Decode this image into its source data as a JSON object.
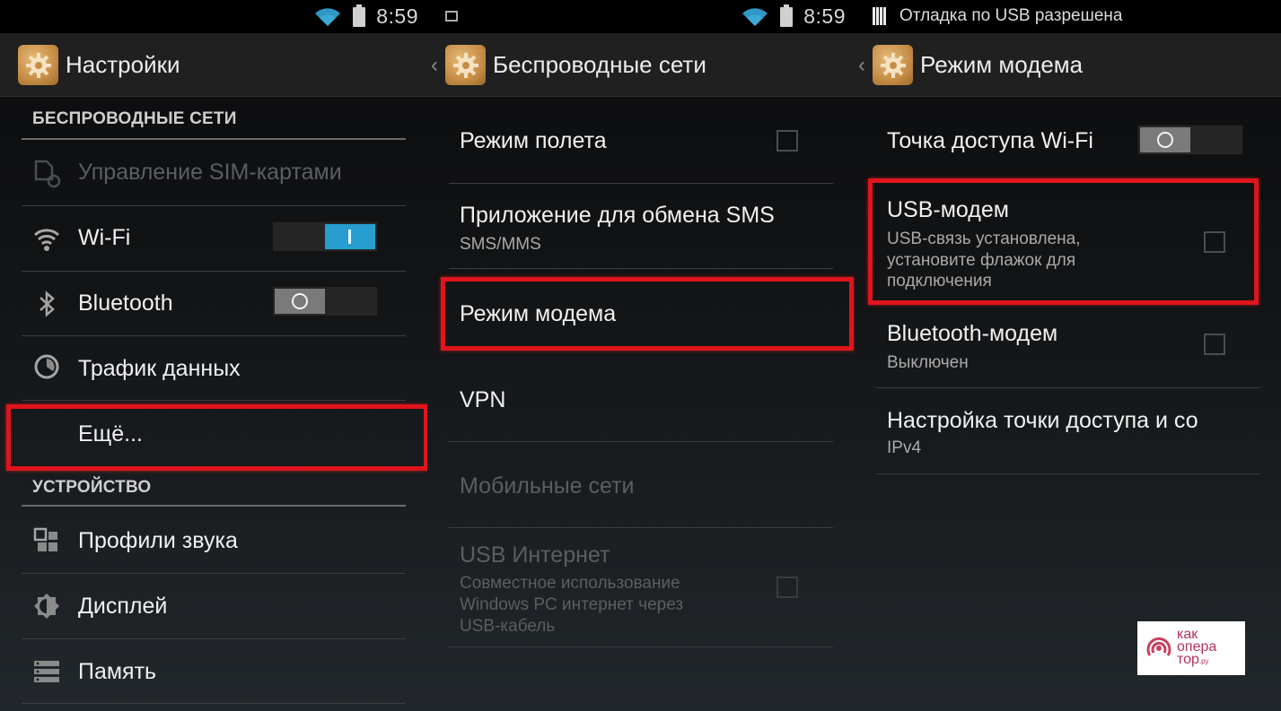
{
  "panel_settings": {
    "status": {
      "time": "8:59"
    },
    "title": "Настройки",
    "sections": [
      {
        "header": "БЕСПРОВОДНЫЕ СЕТИ",
        "items": [
          {
            "label": "Управление SIM-картами",
            "icon": "sim-settings-icon",
            "disabled": true
          },
          {
            "label": "Wi-Fi",
            "icon": "wifi-icon",
            "toggle": "on"
          },
          {
            "label": "Bluetooth",
            "icon": "bluetooth-icon",
            "toggle": "off"
          },
          {
            "label": "Трафик данных",
            "icon": "data-usage-icon"
          },
          {
            "label": "Ещё...",
            "highlighted": true
          }
        ]
      },
      {
        "header": "УСТРОЙСТВО",
        "items": [
          {
            "label": "Профили звука",
            "icon": "sound-profiles-icon"
          },
          {
            "label": "Дисплей",
            "icon": "display-icon"
          },
          {
            "label": "Память",
            "icon": "storage-icon"
          }
        ]
      }
    ]
  },
  "panel_wireless": {
    "status": {
      "time": "8:59"
    },
    "title": "Беспроводные сети",
    "items": [
      {
        "label": "Режим полета",
        "checkbox": false
      },
      {
        "label": "Приложение для обмена SMS",
        "summary": "SMS/MMS"
      },
      {
        "label": "Режим модема",
        "highlighted": true
      },
      {
        "label": "VPN"
      },
      {
        "label": "Мобильные сети",
        "disabled": true
      },
      {
        "label": "USB Интернет",
        "summary_lines": [
          "Совместное использование",
          "Windows PC интернет через",
          "USB-кабель"
        ],
        "checkbox": false,
        "disabled": true
      }
    ]
  },
  "panel_tethering": {
    "status": {
      "notification": "Отладка по USB разрешена"
    },
    "title": "Режим модема",
    "items": [
      {
        "label": "Точка доступа Wi-Fi",
        "toggle": "off"
      },
      {
        "label": "USB-модем",
        "summary_lines": [
          "USB-связь установлена,",
          "установите флажок для",
          "подключения"
        ],
        "checkbox": false,
        "highlighted": true
      },
      {
        "label": "Bluetooth-модем",
        "summary": "Выключен",
        "checkbox": false
      },
      {
        "label": "Настройка точки доступа и со",
        "summary": "IPv4"
      }
    ]
  },
  "watermark": {
    "line1": "как",
    "line2": "опера",
    "line3": "тор",
    "suffix": ".ру"
  },
  "colors": {
    "accent": "#279ecf",
    "highlight": "#e0141c",
    "app_icon": "#c58c45"
  }
}
